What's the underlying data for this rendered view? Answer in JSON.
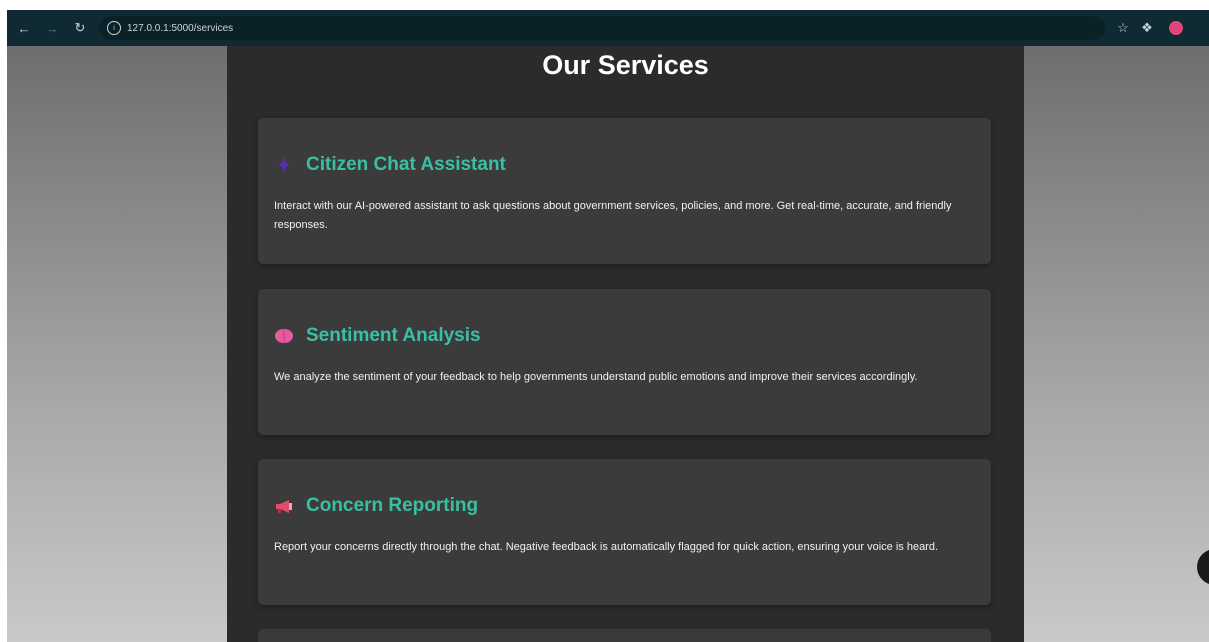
{
  "browser": {
    "url": "127.0.0.1:5000/services",
    "back_icon": "arrow-left",
    "forward_icon": "arrow-right",
    "reload_icon": "reload",
    "bookmark_icon": "star",
    "extensions_icon": "puzzle"
  },
  "page": {
    "title": "Our Services",
    "accent_color": "#39c0a3"
  },
  "services": [
    {
      "icon": "purple-sparkle",
      "title": "Citizen Chat Assistant",
      "description": "Interact with our AI-powered assistant to ask questions about government services, policies, and more. Get real-time, accurate, and friendly responses."
    },
    {
      "icon": "brain",
      "title": "Sentiment Analysis",
      "description": "We analyze the sentiment of your feedback to help governments understand public emotions and improve their services accordingly."
    },
    {
      "icon": "megaphone",
      "title": "Concern Reporting",
      "description": "Report your concerns directly through the chat. Negative feedback is automatically flagged for quick action, ensuring your voice is heard."
    }
  ]
}
